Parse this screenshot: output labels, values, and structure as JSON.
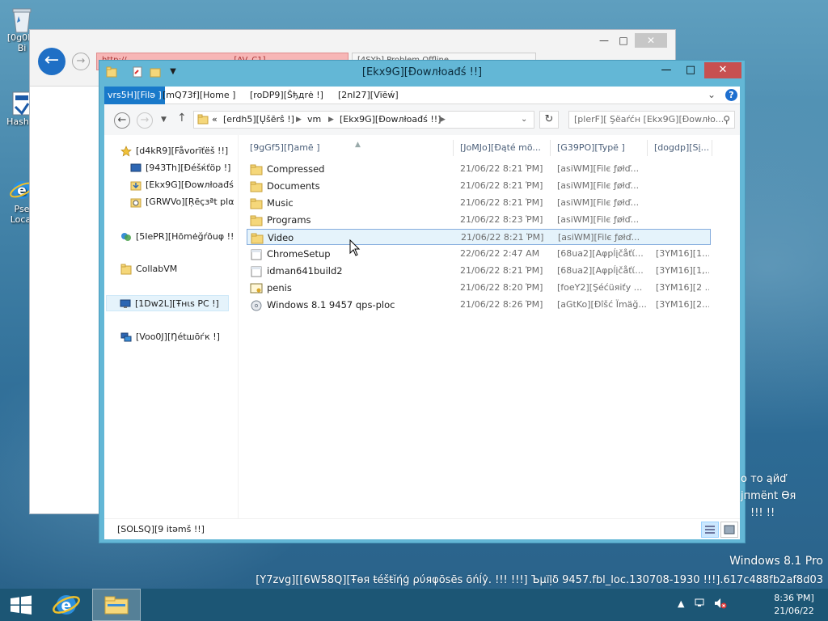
{
  "desktop": {
    "icons": [
      {
        "label": "[0g0IC",
        "label2": "Bi"
      },
      {
        "label": "Hash-c"
      },
      {
        "label": "Pse",
        "label2": "Local"
      }
    ]
  },
  "browser": {
    "tab1": "http://...",
    "tab1_warn": "[AV_C1] ...",
    "tab2": "[4SYb] Problem Offline..."
  },
  "explorer": {
    "title": "[Ekx9G][Ðowлłoađś !!]",
    "ribbon": {
      "file": "vrs5H][Filə ]",
      "home": "[mQ73f][Home ]",
      "share": "[roDP9][Šђдrė !]",
      "view": "[2nI27][Vïēẃ]"
    },
    "address": {
      "overflow": "«",
      "seg1": "[erdh5][Ųšērŝ !]",
      "seg2": "vm",
      "seg3": "[Ekx9G][Ðowлłoađś !!]"
    },
    "search_placeholder": "[plerF][ Şëaŕćн [Ekx9G][Ðowлło...",
    "nav": {
      "favorites": "[d4kR9][Fåvorïťëš !!]",
      "desktop": "[943Th][Ðéšќťöp !]",
      "downloads": "[Ekx9G][Ðowлłoađś",
      "recent": "[GRWVo][Ŗēçзªt plα",
      "homegroup": "[5IePR][Hōmėğŕōuφ !!",
      "collabvm": "CollabVM",
      "thispc": "[1Dw2L][Ŧнιѕ PC !]",
      "network": "[Voo0J][Ŋétшōѓк !]"
    },
    "columns": {
      "name": "[9gGf5][Ŋamē ]",
      "date": "[JoMJo][Ðąté mö...",
      "type": "[G39PO][Typё ]",
      "size": "[dogdp][Sį..."
    },
    "files": [
      {
        "name": "Compressed",
        "date": "21/06/22 8:21 ῬM]",
        "type": "[asiWM][Filє ƒøłď...",
        "size": "",
        "icon": "folder-icon"
      },
      {
        "name": "Documents",
        "date": "21/06/22 8:21 ῬM]",
        "type": "[asiWM][Filє ƒøłď...",
        "size": "",
        "icon": "folder-icon"
      },
      {
        "name": "Music",
        "date": "21/06/22 8:21 ῬM]",
        "type": "[asiWM][Filє ƒøłď...",
        "size": "",
        "icon": "folder-icon"
      },
      {
        "name": "Programs",
        "date": "21/06/22 8:23 ῬM]",
        "type": "[asiWM][Filє ƒøłď...",
        "size": "",
        "icon": "folder-icon"
      },
      {
        "name": "Video",
        "date": "21/06/22 8:21 ῬM]",
        "type": "[asiWM][Filє ƒøłď...",
        "size": "",
        "icon": "folder-icon"
      },
      {
        "name": "ChromeSetup",
        "date": "22/06/22 2:47 AM",
        "type": "[68ua2][Aφрĺįčåťί...",
        "size": "[3YM16][1...",
        "icon": "app-icon"
      },
      {
        "name": "idman641build2",
        "date": "21/06/22 8:21 ῬM]",
        "type": "[68ua2][Aφрĺįčåťί...",
        "size": "[3YM16][1,...",
        "icon": "app-icon"
      },
      {
        "name": "penis",
        "date": "21/06/22 8:20 ῬM]",
        "type": "[foeY2][Şéćüяіťу ...",
        "size": "[3YM16][2 ...",
        "icon": "certificate-icon"
      },
      {
        "name": "Windows 8.1 9457 qps-ploc",
        "date": "21/06/22 8:26 ῬM]",
        "type": "[aGtKo][Ðîšć Ïmäğ...",
        "size": "[3YM16][2...",
        "icon": "disc-image-icon"
      }
    ],
    "status": "[SOLSQ][9 itəmš !!]"
  },
  "watermark": {
    "side1": "o то ąйď",
    "side2": "јпmёnt Өя",
    "side3": "!!! !!",
    "edition": "Windows 8.1 Pro",
    "build": "[Y7zvg][[6W58Q][Ŧөя ŧéšŧĭήģ ρύяφōsēs ōńĺŷ. !!! !!!] Ъμïļδ 9457.fbl_loc.130708-1930 !!!].617c488fb2af8d03"
  },
  "taskbar": {
    "time": "8:36 ῬM]",
    "date": "21/06/22"
  },
  "colors": {
    "explorer_frame": "#63b7d6",
    "file_tab": "#1979ca",
    "selection": "#e5f3fb",
    "taskbar": "#1c5675",
    "close_button": "#c75050"
  }
}
